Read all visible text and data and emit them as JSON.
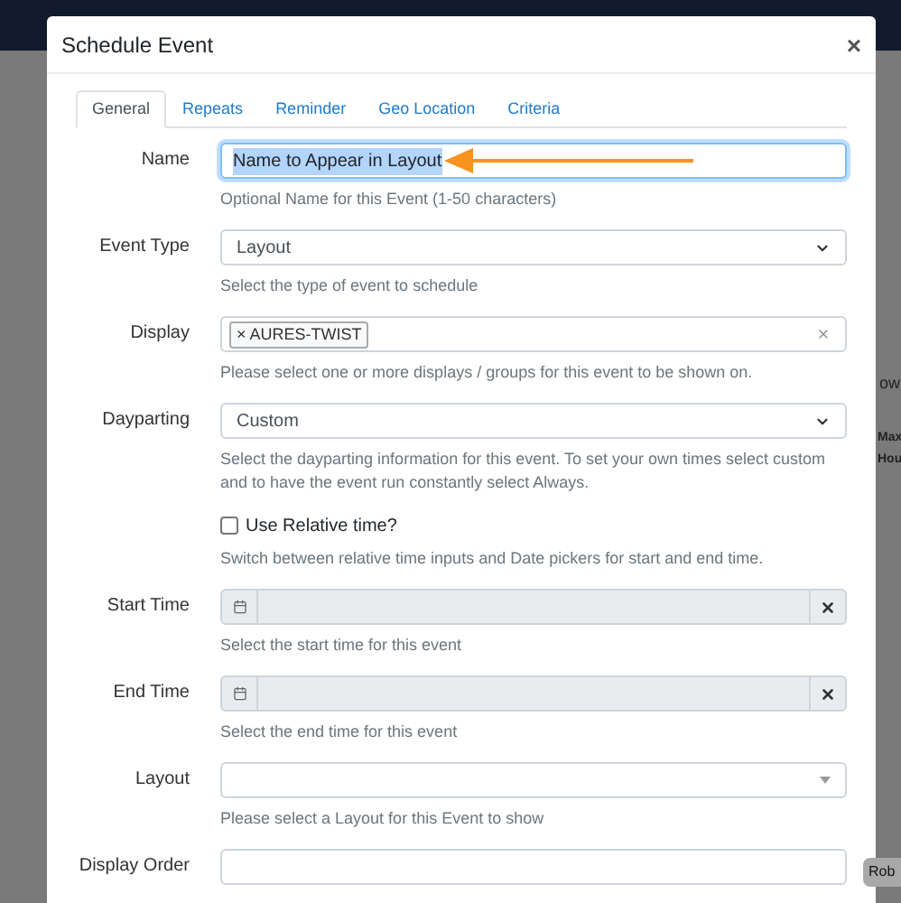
{
  "background": {
    "fragments": [
      "ow",
      "Max",
      "Hou"
    ],
    "tooltip": "Rob"
  },
  "dialog": {
    "title": "Schedule Event",
    "close": "×",
    "tabs": [
      {
        "label": "General",
        "selected": true
      },
      {
        "label": "Repeats",
        "selected": false
      },
      {
        "label": "Reminder",
        "selected": false
      },
      {
        "label": "Geo Location",
        "selected": false
      },
      {
        "label": "Criteria",
        "selected": false
      }
    ],
    "fields": [
      {
        "kind": "text",
        "label": "Name",
        "value": "Name to Appear in Layout",
        "focused": true,
        "help": "Optional Name for this Event (1-50 characters)"
      },
      {
        "kind": "select",
        "label": "Event Type",
        "value": "Layout",
        "help": "Select the type of event to schedule"
      },
      {
        "kind": "tags",
        "label": "Display",
        "tags": [
          {
            "remove": "×",
            "label": "AURES-TWIST"
          }
        ],
        "help": "Please select one or more displays / groups for this event to be shown on."
      },
      {
        "kind": "select",
        "label": "Dayparting",
        "value": "Custom",
        "help": "Select the dayparting information for this event. To set your own times select custom and to have the event run constantly select Always."
      },
      {
        "kind": "checkbox",
        "label": "Use Relative time?",
        "checked": false,
        "help": "Switch between relative time inputs and Date pickers for start and end time."
      },
      {
        "kind": "datetime",
        "label": "Start Time",
        "help": "Select the start time for this event"
      },
      {
        "kind": "datetime",
        "label": "End Time",
        "help": "Select the end time for this event"
      },
      {
        "kind": "combo",
        "label": "Layout",
        "help": "Please select a Layout for this Event to show"
      },
      {
        "kind": "text",
        "label": "Display Order",
        "focused": false
      }
    ]
  }
}
